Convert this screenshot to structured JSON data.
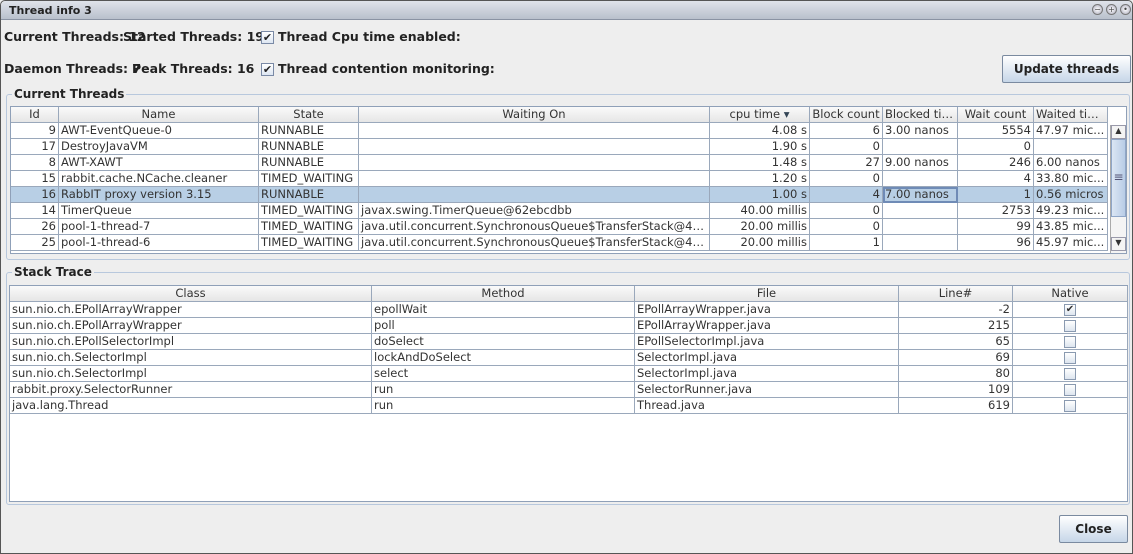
{
  "window": {
    "title": "Thread info 3",
    "controls": [
      "minimize",
      "maximize",
      "close"
    ]
  },
  "stats": {
    "current": "Current Threads: 12",
    "started": "Started Threads: 19",
    "daemon": "Daemon Threads: 7",
    "peak": "Peak Threads: 16",
    "cpu_time_label": "Thread Cpu time enabled:",
    "cpu_time_checked": true,
    "contention_label": "Thread contention monitoring:",
    "contention_checked": true
  },
  "update_button": "Update threads",
  "threads": {
    "title": "Current Threads",
    "sort_icon": "sort-descending-icon",
    "columns": [
      "Id",
      "Name",
      "State",
      "Waiting On",
      "cpu time",
      "Block count",
      "Blocked time",
      "Wait count",
      "Waited time"
    ],
    "selected_row": 4,
    "rows": [
      [
        "9",
        "AWT-EventQueue-0",
        "RUNNABLE",
        "",
        "4.08 s",
        "6",
        "3.00 nanos",
        "5554",
        "47.97 mic..."
      ],
      [
        "17",
        "DestroyJavaVM",
        "RUNNABLE",
        "",
        "1.90 s",
        "0",
        "",
        "0",
        ""
      ],
      [
        "8",
        "AWT-XAWT",
        "RUNNABLE",
        "",
        "1.48 s",
        "27",
        "9.00 nanos",
        "246",
        "6.00 nanos"
      ],
      [
        "15",
        "rabbit.cache.NCache.cleaner",
        "TIMED_WAITING",
        "",
        "1.20 s",
        "0",
        "",
        "4",
        "33.80 mic..."
      ],
      [
        "16",
        "RabbIT proxy version 3.15",
        "RUNNABLE",
        "",
        "1.00 s",
        "4",
        "7.00 nanos",
        "1",
        "0.56 micros"
      ],
      [
        "14",
        "TimerQueue",
        "TIMED_WAITING",
        "javax.swing.TimerQueue@62ebcdbb",
        "40.00 millis",
        "0",
        "",
        "2753",
        "49.23 mic..."
      ],
      [
        "26",
        "pool-1-thread-7",
        "TIMED_WAITING",
        "java.util.concurrent.SynchronousQueue$TransferStack@49...",
        "20.00 millis",
        "0",
        "",
        "99",
        "43.85 mic..."
      ],
      [
        "25",
        "pool-1-thread-6",
        "TIMED_WAITING",
        "java.util.concurrent.SynchronousQueue$TransferStack@49...",
        "20.00 millis",
        "1",
        "",
        "96",
        "45.97 mic..."
      ]
    ]
  },
  "stack": {
    "title": "Stack Trace",
    "columns": [
      "Class",
      "Method",
      "File",
      "Line#",
      "Native"
    ],
    "rows": [
      [
        "sun.nio.ch.EPollArrayWrapper",
        "epollWait",
        "EPollArrayWrapper.java",
        "-2",
        true
      ],
      [
        "sun.nio.ch.EPollArrayWrapper",
        "poll",
        "EPollArrayWrapper.java",
        "215",
        false
      ],
      [
        "sun.nio.ch.EPollSelectorImpl",
        "doSelect",
        "EPollSelectorImpl.java",
        "65",
        false
      ],
      [
        "sun.nio.ch.SelectorImpl",
        "lockAndDoSelect",
        "SelectorImpl.java",
        "69",
        false
      ],
      [
        "sun.nio.ch.SelectorImpl",
        "select",
        "SelectorImpl.java",
        "80",
        false
      ],
      [
        "rabbit.proxy.SelectorRunner",
        "run",
        "SelectorRunner.java",
        "109",
        false
      ],
      [
        "java.lang.Thread",
        "run",
        "Thread.java",
        "619",
        false
      ]
    ]
  },
  "close_button": "Close"
}
